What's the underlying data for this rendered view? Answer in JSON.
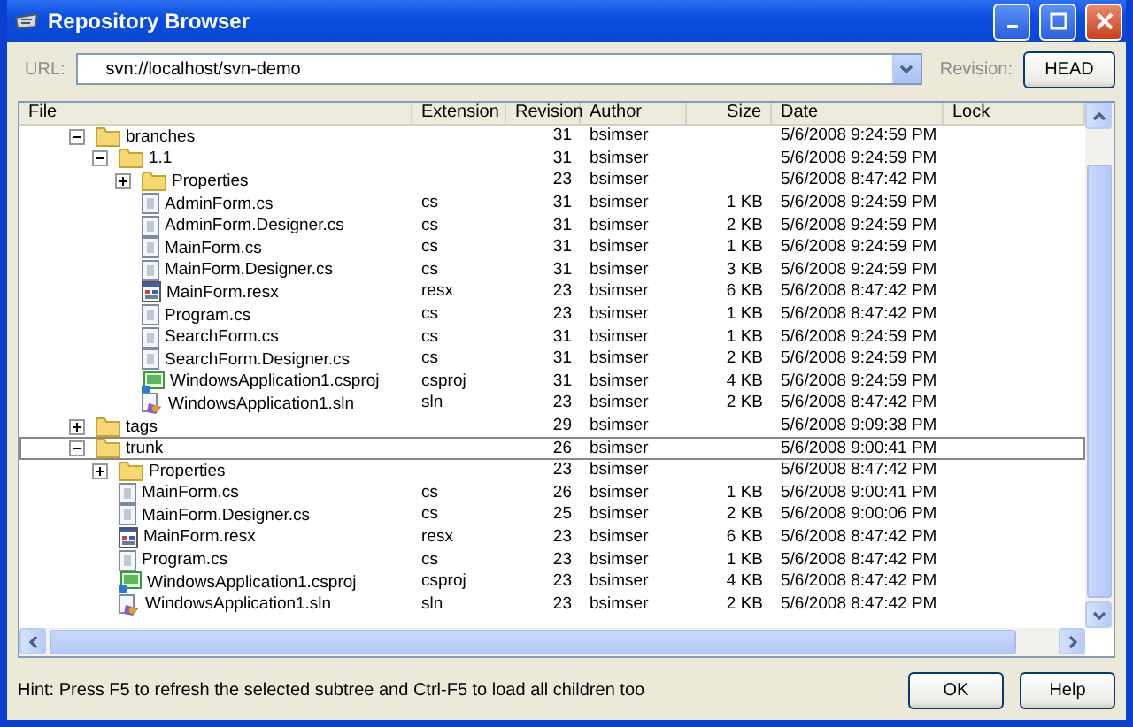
{
  "window": {
    "title": "Repository Browser"
  },
  "url": {
    "label": "URL:",
    "value": "svn://localhost/svn-demo"
  },
  "revision": {
    "label": "Revision:",
    "button": "HEAD"
  },
  "columns": [
    "File",
    "Extension",
    "Revision",
    "Author",
    "Size",
    "Date",
    "Lock"
  ],
  "tree": [
    {
      "kind": "folder",
      "name": "branches",
      "revision": "31",
      "author": "bsimser",
      "date": "5/6/2008 9:24:59 PM",
      "expanded": true,
      "selected": false,
      "children": [
        {
          "kind": "folder",
          "name": "1.1",
          "revision": "31",
          "author": "bsimser",
          "date": "5/6/2008 9:24:59 PM",
          "expanded": true,
          "selected": false,
          "children": [
            {
              "kind": "folder",
              "name": "Properties",
              "revision": "23",
              "author": "bsimser",
              "date": "5/6/2008 8:47:42 PM",
              "expanded": false,
              "selected": false
            },
            {
              "kind": "code",
              "name": "AdminForm.cs",
              "extension": "cs",
              "revision": "31",
              "author": "bsimser",
              "size": "1 KB",
              "date": "5/6/2008 9:24:59 PM",
              "selected": false
            },
            {
              "kind": "code",
              "name": "AdminForm.Designer.cs",
              "extension": "cs",
              "revision": "31",
              "author": "bsimser",
              "size": "2 KB",
              "date": "5/6/2008 9:24:59 PM",
              "selected": false
            },
            {
              "kind": "code",
              "name": "MainForm.cs",
              "extension": "cs",
              "revision": "31",
              "author": "bsimser",
              "size": "1 KB",
              "date": "5/6/2008 9:24:59 PM",
              "selected": false
            },
            {
              "kind": "code",
              "name": "MainForm.Designer.cs",
              "extension": "cs",
              "revision": "31",
              "author": "bsimser",
              "size": "3 KB",
              "date": "5/6/2008 9:24:59 PM",
              "selected": false
            },
            {
              "kind": "resx",
              "name": "MainForm.resx",
              "extension": "resx",
              "revision": "23",
              "author": "bsimser",
              "size": "6 KB",
              "date": "5/6/2008 8:47:42 PM",
              "selected": false
            },
            {
              "kind": "code",
              "name": "Program.cs",
              "extension": "cs",
              "revision": "23",
              "author": "bsimser",
              "size": "1 KB",
              "date": "5/6/2008 8:47:42 PM",
              "selected": false
            },
            {
              "kind": "code",
              "name": "SearchForm.cs",
              "extension": "cs",
              "revision": "31",
              "author": "bsimser",
              "size": "1 KB",
              "date": "5/6/2008 9:24:59 PM",
              "selected": false
            },
            {
              "kind": "code",
              "name": "SearchForm.Designer.cs",
              "extension": "cs",
              "revision": "31",
              "author": "bsimser",
              "size": "2 KB",
              "date": "5/6/2008 9:24:59 PM",
              "selected": false
            },
            {
              "kind": "csproj",
              "name": "WindowsApplication1.csproj",
              "extension": "csproj",
              "revision": "31",
              "author": "bsimser",
              "size": "4 KB",
              "date": "5/6/2008 9:24:59 PM",
              "selected": false
            },
            {
              "kind": "sln",
              "name": "WindowsApplication1.sln",
              "extension": "sln",
              "revision": "23",
              "author": "bsimser",
              "size": "2 KB",
              "date": "5/6/2008 8:47:42 PM",
              "selected": false
            }
          ]
        }
      ]
    },
    {
      "kind": "folder",
      "name": "tags",
      "revision": "29",
      "author": "bsimser",
      "date": "5/6/2008 9:09:38 PM",
      "expanded": false,
      "selected": false
    },
    {
      "kind": "folder",
      "name": "trunk",
      "revision": "26",
      "author": "bsimser",
      "date": "5/6/2008 9:00:41 PM",
      "expanded": true,
      "selected": true,
      "children": [
        {
          "kind": "folder",
          "name": "Properties",
          "revision": "23",
          "author": "bsimser",
          "date": "5/6/2008 8:47:42 PM",
          "expanded": false,
          "selected": false
        },
        {
          "kind": "code",
          "name": "MainForm.cs",
          "extension": "cs",
          "revision": "26",
          "author": "bsimser",
          "size": "1 KB",
          "date": "5/6/2008 9:00:41 PM",
          "selected": false
        },
        {
          "kind": "code",
          "name": "MainForm.Designer.cs",
          "extension": "cs",
          "revision": "25",
          "author": "bsimser",
          "size": "2 KB",
          "date": "5/6/2008 9:00:06 PM",
          "selected": false
        },
        {
          "kind": "resx",
          "name": "MainForm.resx",
          "extension": "resx",
          "revision": "23",
          "author": "bsimser",
          "size": "6 KB",
          "date": "5/6/2008 8:47:42 PM",
          "selected": false
        },
        {
          "kind": "code",
          "name": "Program.cs",
          "extension": "cs",
          "revision": "23",
          "author": "bsimser",
          "size": "1 KB",
          "date": "5/6/2008 8:47:42 PM",
          "selected": false
        },
        {
          "kind": "csproj",
          "name": "WindowsApplication1.csproj",
          "extension": "csproj",
          "revision": "23",
          "author": "bsimser",
          "size": "4 KB",
          "date": "5/6/2008 8:47:42 PM",
          "selected": false
        },
        {
          "kind": "sln",
          "name": "WindowsApplication1.sln",
          "extension": "sln",
          "revision": "23",
          "author": "bsimser",
          "size": "2 KB",
          "date": "5/6/2008 8:47:42 PM",
          "selected": false
        }
      ]
    }
  ],
  "hint": "Hint: Press F5 to refresh the selected subtree and Ctrl-F5 to load all children too",
  "buttons": [
    "OK",
    "Help"
  ]
}
